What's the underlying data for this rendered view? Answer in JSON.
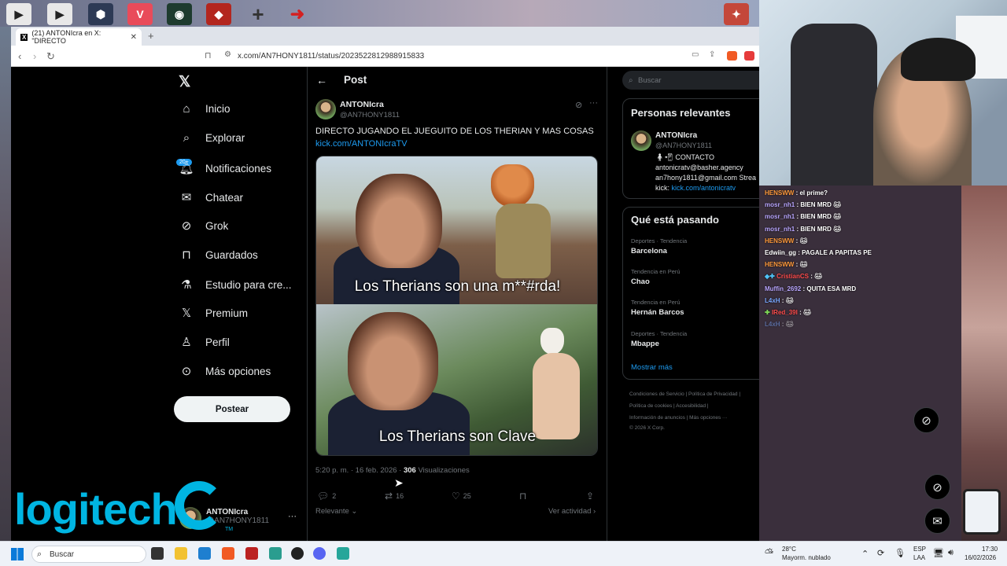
{
  "browser": {
    "tab_title": "(21) ANTONIcra en X: \"DIRECTO",
    "new_tab": "+",
    "url": "x.com/AN7HONY1811/status/2023522812988915833"
  },
  "sidebar": {
    "items": [
      {
        "label": "Inicio",
        "icon": "home-icon"
      },
      {
        "label": "Explorar",
        "icon": "search-icon"
      },
      {
        "label": "Notificaciones",
        "icon": "bell-icon"
      },
      {
        "label": "Chatear",
        "icon": "mail-icon"
      },
      {
        "label": "Grok",
        "icon": "grok-icon"
      },
      {
        "label": "Guardados",
        "icon": "bookmark-icon"
      },
      {
        "label": "Estudio para cre...",
        "icon": "studio-icon"
      },
      {
        "label": "Premium",
        "icon": "x-icon"
      },
      {
        "label": "Perfil",
        "icon": "person-icon"
      },
      {
        "label": "Más opciones",
        "icon": "more-icon"
      }
    ],
    "notif_badge": "20+",
    "post_button": "Postear",
    "account_name": "ANTONIcra",
    "account_handle": "@AN7HONY1811",
    "account_more": "···"
  },
  "post": {
    "header_title": "Post",
    "author_name": "ANTONIcra",
    "author_handle": "@AN7HONY1811",
    "text": "DIRECTO JUGANDO EL JUEGUITO DE LOS THERIAN Y MAS COSAS",
    "link": "kick.com/ANTONIcraTV",
    "caption_top": "Los Therians son una m**#rda!",
    "caption_bottom": "Los Therians son Clave",
    "time": "5:20 p. m. · 16 feb. 2026 ·",
    "views_count": "306",
    "views_label": "Visualizaciones",
    "replies": "2",
    "reposts": "16",
    "likes": "25",
    "relevant": "Relevante",
    "see_activity": "Ver actividad"
  },
  "right": {
    "search_placeholder": "Buscar",
    "relevant_title": "Personas relevantes",
    "relevant_name": "ANTONIcra",
    "relevant_handle": "@AN7HONY1811",
    "bio_contact": "CONTACTO",
    "bio_email1": "antonicratv@basher.agency",
    "bio_email2": "an7hony1811@gmail.com Strea",
    "bio_kick_label": "kick:",
    "bio_kick_link": "kick.com/antonicratv",
    "trends_title": "Qué está pasando",
    "trends": [
      {
        "category": "Deportes · Tendencia",
        "name": "Barcelona"
      },
      {
        "category": "Tendencia en Perú",
        "name": "Chao"
      },
      {
        "category": "Tendencia en Perú",
        "name": "Hernán Barcos"
      },
      {
        "category": "Deportes · Tendencia",
        "name": "Mbappe"
      }
    ],
    "show_more": "Mostrar más",
    "footer": [
      "Condiciones de Servicio  |  Política de Privacidad  |",
      "Política de cookies  |  Accesibilidad  |",
      "Información de anuncios  |  Más opciones ···",
      "© 2026 X Corp."
    ]
  },
  "chat": [
    {
      "user": "HENSWW",
      "msg": ": el prime?",
      "color": "#ff9a3c"
    },
    {
      "user": "mosr_nh1",
      "msg": ": BIEN MRD",
      "color": "#b9a6ff"
    },
    {
      "user": "mosr_nh1",
      "msg": ": BIEN MRD",
      "color": "#b9a6ff"
    },
    {
      "user": "mosr_nh1",
      "msg": ": BIEN MRD",
      "color": "#b9a6ff"
    },
    {
      "user": "HENSWW",
      "msg": ":",
      "color": "#ff9a3c"
    },
    {
      "user": "Edwiin_gg",
      "msg": ": PAGALE A PAPITAS PE",
      "color": "#ffffff"
    },
    {
      "user": "HENSWW",
      "msg": ":",
      "color": "#ff9a3c"
    },
    {
      "user": "CristianCS",
      "msg": ":",
      "color": "#ff4d4d"
    },
    {
      "user": "Muffin_2692",
      "msg": ": QUITA ESA MRD",
      "color": "#b9a6ff"
    },
    {
      "user": "L4xH",
      "msg": ":",
      "color": "#7aa8ff"
    },
    {
      "user": "IRed_39I",
      "msg": ":",
      "color": "#ff4d4d"
    },
    {
      "user": "L4xH",
      "msg": ":",
      "color": "#7aa8ff"
    }
  ],
  "overlay": {
    "logi_text": "logitech",
    "tm": "TM"
  },
  "taskbar": {
    "search": "Buscar",
    "temp": "28°C",
    "weather": "Mayorm. nublado",
    "lang1": "ESP",
    "lang2": "LAA",
    "time": "17:30",
    "date": "16/02/2026"
  },
  "colors": {
    "accent": "#1d9bf0",
    "background": "#000000",
    "logitech": "#00b5e2"
  }
}
